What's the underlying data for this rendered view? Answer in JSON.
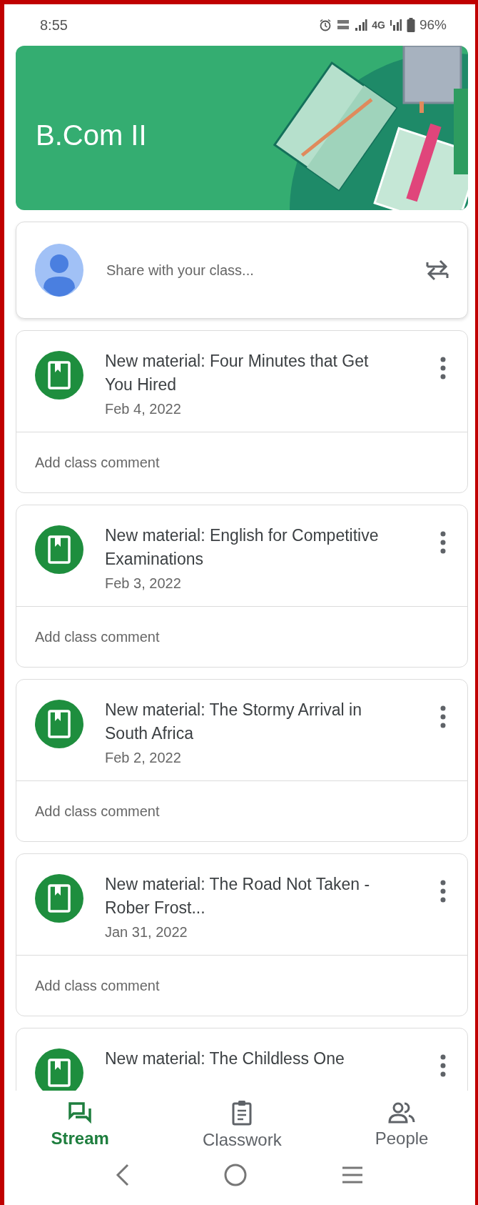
{
  "status_bar": {
    "time": "8:55",
    "network_label": "4G",
    "battery": "96%"
  },
  "class_header": {
    "title": "B.Com II"
  },
  "share_box": {
    "placeholder": "Share with your class..."
  },
  "posts": [
    {
      "title": "New material: Four Minutes that Get You Hired",
      "date": "Feb 4, 2022",
      "comment_placeholder": "Add class comment"
    },
    {
      "title": "New material: English for Competitive Examinations",
      "date": "Feb 3, 2022",
      "comment_placeholder": "Add class comment"
    },
    {
      "title": "New material: The Stormy Arrival in South Africa",
      "date": "Feb 2, 2022",
      "comment_placeholder": "Add class comment"
    },
    {
      "title": "New material: The Road Not Taken -Rober Frost...",
      "date": "Jan 31, 2022",
      "comment_placeholder": "Add class comment"
    },
    {
      "title": "New material: The Childless One"
    }
  ],
  "bottom_nav": [
    {
      "kind": "stream",
      "label": "Stream",
      "selected": true
    },
    {
      "kind": "classwork",
      "label": "Classwork",
      "selected": false
    },
    {
      "kind": "people",
      "label": "People",
      "selected": false
    }
  ]
}
